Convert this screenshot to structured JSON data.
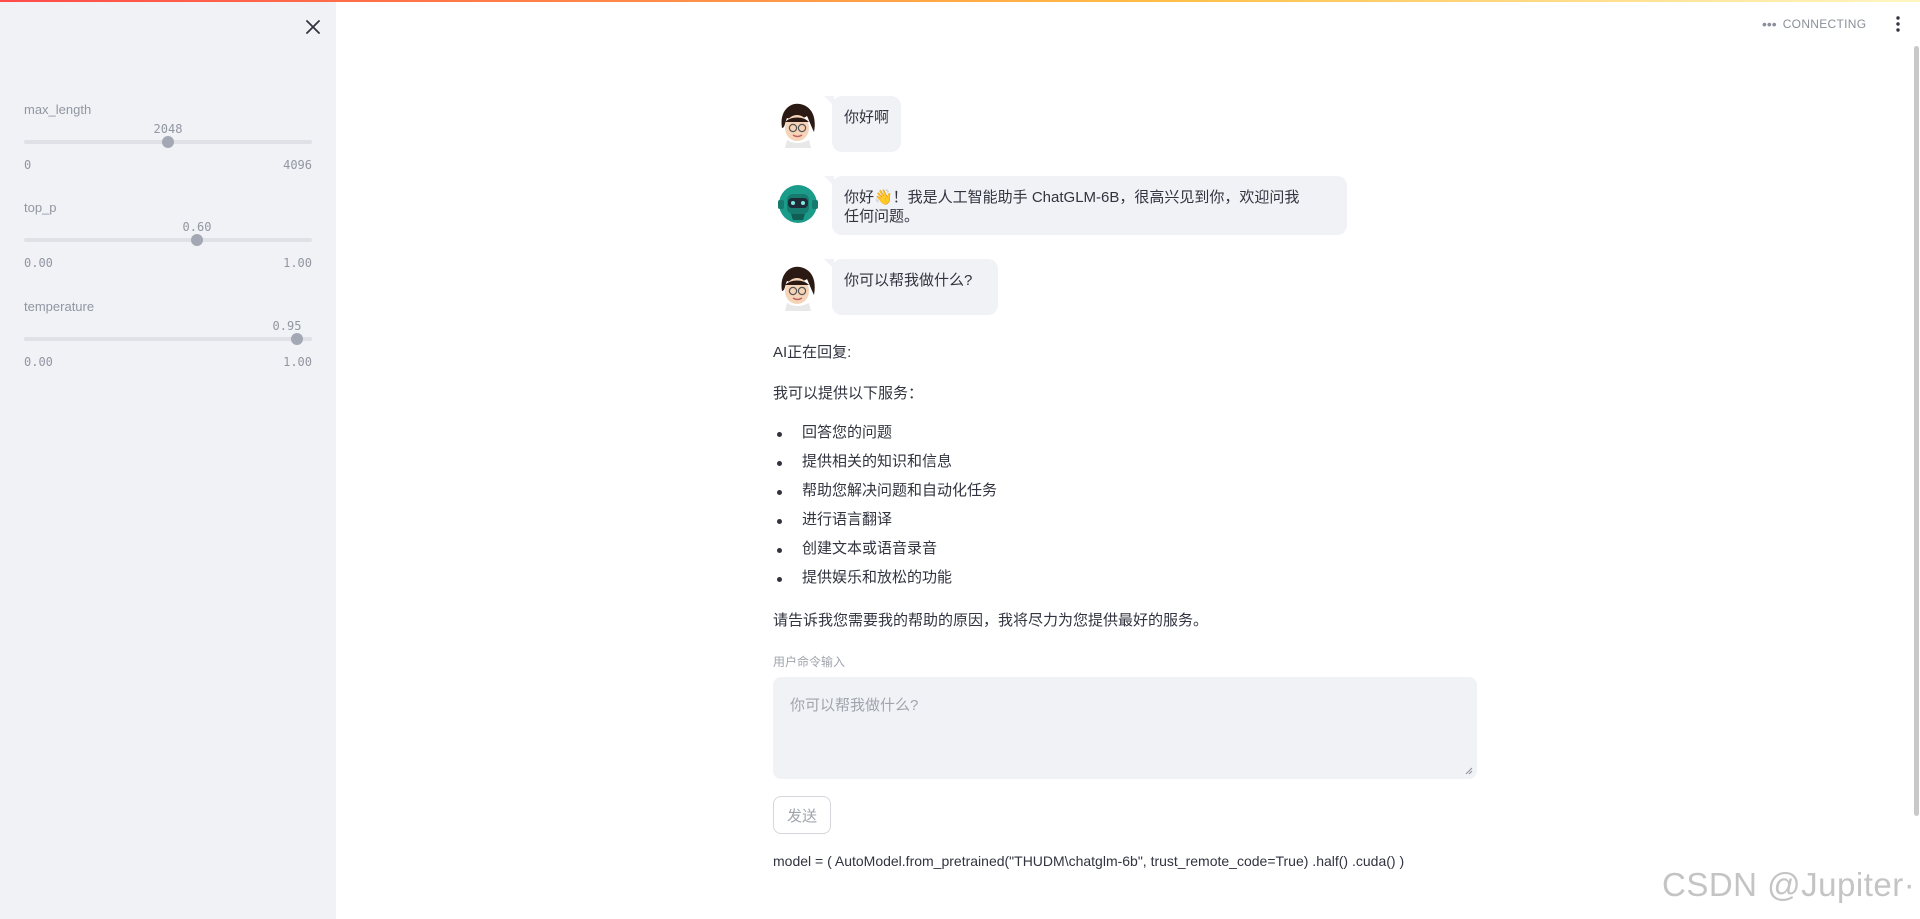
{
  "header": {
    "status_text": "CONNECTING",
    "status_icon": "more-horizontal-icon",
    "menu_icon": "more-vertical-icon"
  },
  "sidebar": {
    "close_icon": "close-icon",
    "sliders": [
      {
        "label": "max_length",
        "value": "2048",
        "min": "0",
        "max": "4096",
        "fraction": 0.5
      },
      {
        "label": "top_p",
        "value": "0.60",
        "min": "0.00",
        "max": "1.00",
        "fraction": 0.6
      },
      {
        "label": "temperature",
        "value": "0.95",
        "min": "0.00",
        "max": "1.00",
        "fraction": 0.95
      }
    ]
  },
  "chat": {
    "messages": [
      {
        "role": "user",
        "avatar": "user-avatar",
        "text": "你好啊"
      },
      {
        "role": "assistant",
        "avatar": "bot-avatar",
        "line1": "你好👋！我是人工智能助手 ChatGLM-6B，很高兴见到你，欢迎问我",
        "line2": "任何问题。"
      },
      {
        "role": "user",
        "avatar": "user-avatar",
        "text": "你可以帮我做什么?"
      }
    ],
    "reply_label": "AI正在回复:",
    "reply_intro": "我可以提供以下服务：",
    "reply_items": [
      "回答您的问题",
      "提供相关的知识和信息",
      "帮助您解决问题和自动化任务",
      "进行语言翻译",
      "创建文本或语音录音",
      "提供娱乐和放松的功能"
    ],
    "reply_outro": "请告诉我您需要我的帮助的原因，我将尽力为您提供最好的服务。"
  },
  "input": {
    "label": "用户命令输入",
    "placeholder": "你可以帮我做什么?",
    "send_label": "发送"
  },
  "code_line": "model = ( AutoModel.from_pretrained(\"THUDM\\chatglm-6b\", trust_remote_code=True) .half() .cuda() )",
  "watermark": "CSDN @Jupiter·"
}
